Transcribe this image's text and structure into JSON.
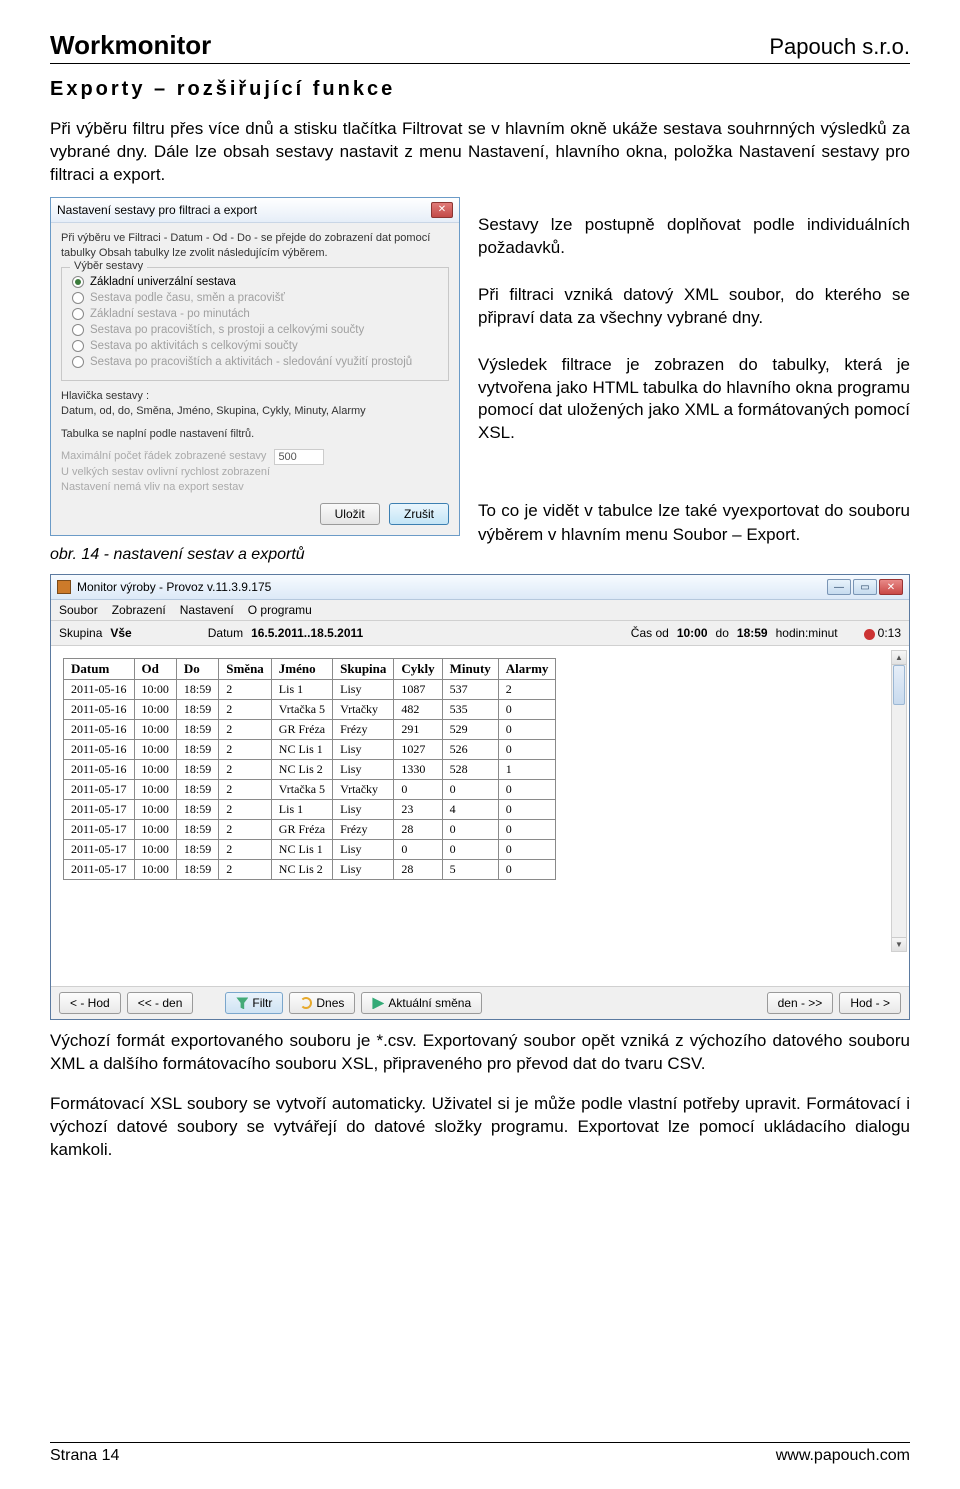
{
  "header": {
    "left": "Workmonitor",
    "right": "Papouch s.r.o."
  },
  "section_title": "Exporty – rozšiřující funkce",
  "intro_p1": "Při výběru filtru přes více dnů a stisku tlačítka Filtrovat se v hlavním okně ukáže sestava souhrnných výsledků za vybrané dny. Dále lze obsah sestavy nastavit z menu Nastavení, hlavního okna, položka Nastavení sestavy pro filtraci a export.",
  "dialog": {
    "title": "Nastavení sestavy pro filtraci a export",
    "hint": "Při výběru ve Filtraci - Datum - Od - Do - se přejde do zobrazení dat pomocí tabulky Obsah tabulky lze zvolit následujícím výběrem.",
    "legend": "Výběr sestavy",
    "options": [
      "Základní univerzální sestava",
      "Sestava podle času, směn a pracovišť",
      "Základní sestava - po minutách",
      "Sestava po pracovištích, s prostoji a celkovými součty",
      "Sestava po aktivitách s celkovými součty",
      "Sestava po pracovištích a aktivitách - sledování využití prostojů"
    ],
    "hlav_label": "Hlavička sestavy :",
    "hlav_value": "Datum, od, do, Směna, Jméno, Skupina, Cykly, Minuty, Alarmy",
    "tabul": "Tabulka se naplní podle nastavení filtrů.",
    "max_label": "Maximální počet řádek zobrazené sestavy",
    "max_value": "500",
    "note1": "U velkých sestav ovlivní rychlost zobrazení",
    "note2": "Nastavení nemá vliv na export sestav",
    "btn_save": "Uložit",
    "btn_cancel": "Zrušit"
  },
  "side": {
    "p1": "Sestavy lze postupně doplňovat podle individuálních požadavků.",
    "p2": "Při filtraci vzniká datový XML soubor, do kterého se připraví data za všechny vybrané dny.",
    "p3": "Výsledek filtrace je zobrazen do tabulky, která je vytvořena jako HTML tabulka do hlavního okna programu pomocí dat uložených jako XML a formátovaných pomocí XSL."
  },
  "caption": "obr. 14 - nastavení sestav a exportů",
  "right_under_caption": "To co je vidět v tabulce lze také vyexportovat do souboru výběrem v hlavním menu Soubor – Export.",
  "app": {
    "title": "Monitor výroby - Provoz v.11.3.9.175",
    "menu": [
      "Soubor",
      "Zobrazení",
      "Nastavení",
      "O programu"
    ],
    "tb": {
      "sk_label": "Skupina",
      "sk_val": "Vše",
      "dt_label": "Datum",
      "dt_val": "16.5.2011..18.5.2011",
      "co_label": "Čas  od",
      "co_val": "10:00",
      "do_label": "do",
      "do_val": "18:59",
      "hm": "hodin:minut",
      "rec": "0:13"
    },
    "cols": [
      "Datum",
      "Od",
      "Do",
      "Směna",
      "Jméno",
      "Skupina",
      "Cykly",
      "Minuty",
      "Alarmy"
    ],
    "rows": [
      [
        "2011-05-16",
        "10:00",
        "18:59",
        "2",
        "Lis 1",
        "Lisy",
        "1087",
        "537",
        "2"
      ],
      [
        "2011-05-16",
        "10:00",
        "18:59",
        "2",
        "Vrtačka 5",
        "Vrtačky",
        "482",
        "535",
        "0"
      ],
      [
        "2011-05-16",
        "10:00",
        "18:59",
        "2",
        "GR Fréza",
        "Frézy",
        "291",
        "529",
        "0"
      ],
      [
        "2011-05-16",
        "10:00",
        "18:59",
        "2",
        "NC Lis 1",
        "Lisy",
        "1027",
        "526",
        "0"
      ],
      [
        "2011-05-16",
        "10:00",
        "18:59",
        "2",
        "NC Lis 2",
        "Lisy",
        "1330",
        "528",
        "1"
      ],
      [
        "2011-05-17",
        "10:00",
        "18:59",
        "2",
        "Vrtačka 5",
        "Vrtačky",
        "0",
        "0",
        "0"
      ],
      [
        "2011-05-17",
        "10:00",
        "18:59",
        "2",
        "Lis 1",
        "Lisy",
        "23",
        "4",
        "0"
      ],
      [
        "2011-05-17",
        "10:00",
        "18:59",
        "2",
        "GR Fréza",
        "Frézy",
        "28",
        "0",
        "0"
      ],
      [
        "2011-05-17",
        "10:00",
        "18:59",
        "2",
        "NC Lis 1",
        "Lisy",
        "0",
        "0",
        "0"
      ],
      [
        "2011-05-17",
        "10:00",
        "18:59",
        "2",
        "NC Lis 2",
        "Lisy",
        "28",
        "5",
        "0"
      ]
    ],
    "bb": {
      "b1": "< - Hod",
      "b2": "<< - den",
      "b3": "Filtr",
      "b4": "Dnes",
      "b5": "Aktuální směna",
      "b6": "den - >>",
      "b7": "Hod - >"
    }
  },
  "after_app_p1": "Výchozí formát exportovaného souboru je *.csv. Exportovaný soubor opět vzniká z výchozího datového souboru XML a dalšího formátovacího souboru XSL, připraveného pro převod dat do tvaru CSV.",
  "after_app_p2": "Formátovací XSL soubory se vytvoří automaticky. Uživatel si je může podle vlastní potřeby upravit. Formátovací i výchozí datové soubory se vytvářejí do datové složky programu. Exportovat lze pomocí ukládacího dialogu kamkoli.",
  "footer": {
    "left": "Strana 14",
    "right": "www.papouch.com"
  }
}
